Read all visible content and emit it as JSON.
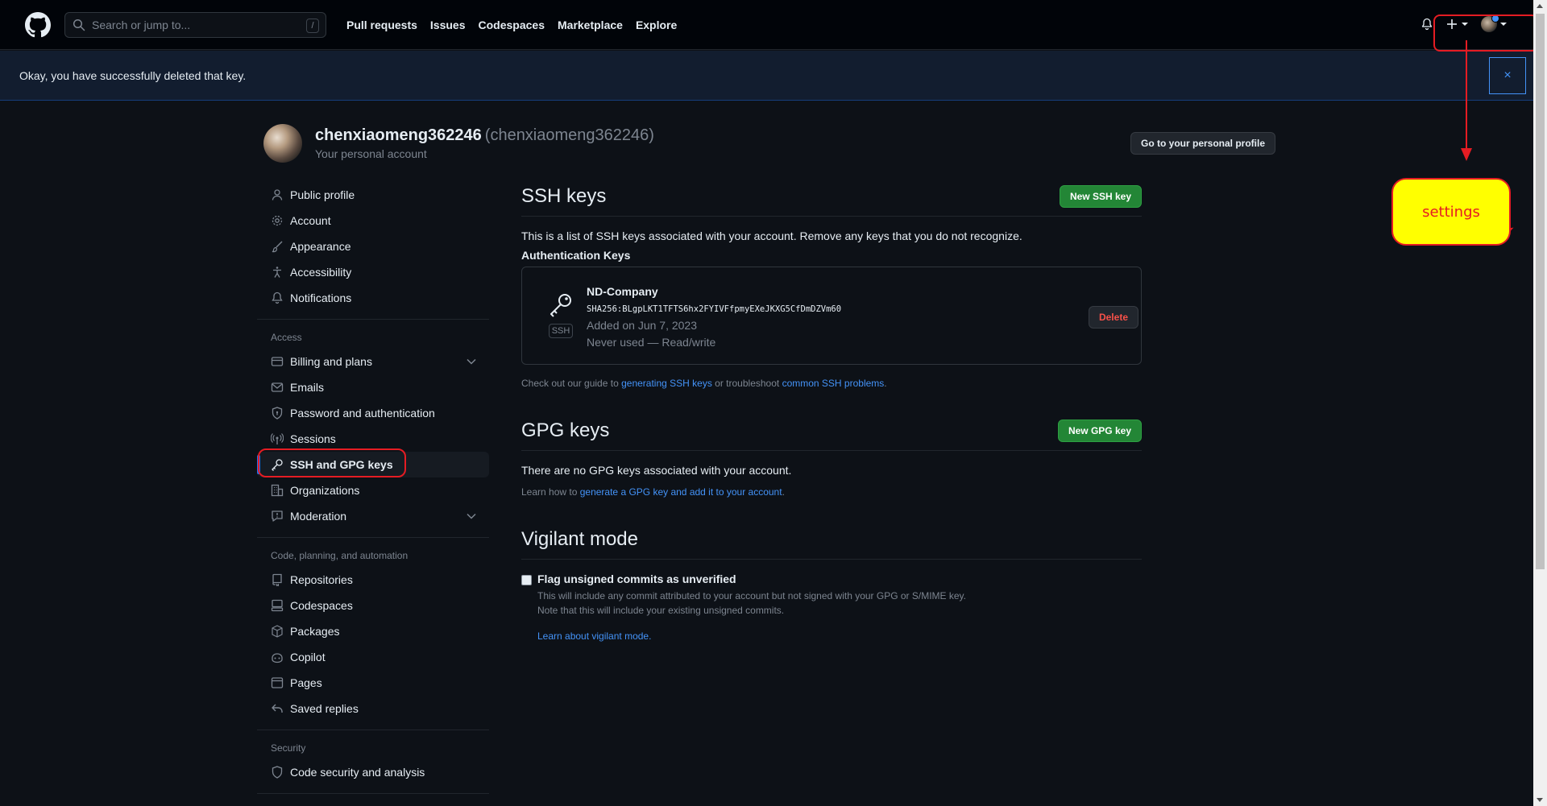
{
  "header": {
    "search_placeholder": "Search or jump to...",
    "search_shortcut": "/",
    "nav": [
      "Pull requests",
      "Issues",
      "Codespaces",
      "Marketplace",
      "Explore"
    ]
  },
  "flash": {
    "message": "Okay, you have successfully deleted that key.",
    "close": "×"
  },
  "profile": {
    "name": "chenxiaomeng362246",
    "handle": "(chenxiaomeng362246)",
    "subtitle": "Your personal account",
    "go_profile_button": "Go to your personal profile"
  },
  "sidebar": {
    "group1": [
      "Public profile",
      "Account",
      "Appearance",
      "Accessibility",
      "Notifications"
    ],
    "access_heading": "Access",
    "access": [
      "Billing and plans",
      "Emails",
      "Password and authentication",
      "Sessions",
      "SSH and GPG keys",
      "Organizations",
      "Moderation"
    ],
    "code_heading": "Code, planning, and automation",
    "code": [
      "Repositories",
      "Codespaces",
      "Packages",
      "Copilot",
      "Pages",
      "Saved replies"
    ],
    "security_heading": "Security",
    "security": [
      "Code security and analysis"
    ]
  },
  "ssh": {
    "title": "SSH keys",
    "new_button": "New SSH key",
    "description": "This is a list of SSH keys associated with your account. Remove any keys that you do not recognize.",
    "auth_heading": "Authentication Keys",
    "key": {
      "title": "ND-Company",
      "fingerprint": "SHA256:BLgpLKT1TFTS6hx2FYIVFfpmyEXeJKXG5CfDmDZVm60",
      "added": "Added on Jun 7, 2023",
      "usage": "Never used — Read/write",
      "badge": "SSH",
      "delete_button": "Delete"
    },
    "guide_prefix": "Check out our guide to",
    "guide_link1": "generating SSH keys",
    "guide_mid": "or troubleshoot",
    "guide_link2": "common SSH problems",
    "guide_suffix": "."
  },
  "gpg": {
    "title": "GPG keys",
    "new_button": "New GPG key",
    "empty": "There are no GPG keys associated with your account.",
    "learn_prefix": "Learn how to",
    "learn_link": "generate a GPG key and add it to your account",
    "learn_suffix": "."
  },
  "vigilant": {
    "title": "Vigilant mode",
    "checkbox_label": "Flag unsigned commits as unverified",
    "desc1": "This will include any commit attributed to your account but not signed with your GPG or S/MIME key.",
    "desc2": "Note that this will include your existing unsigned commits.",
    "learn_link": "Learn about vigilant mode."
  },
  "annotation": {
    "callout_text": "settings",
    "color": "#e51c23",
    "callout_fill": "#ffff00"
  },
  "colors": {
    "accent": "#1f6feb",
    "primary_button": "#238636",
    "danger": "#f85149",
    "link": "#4493f8"
  }
}
